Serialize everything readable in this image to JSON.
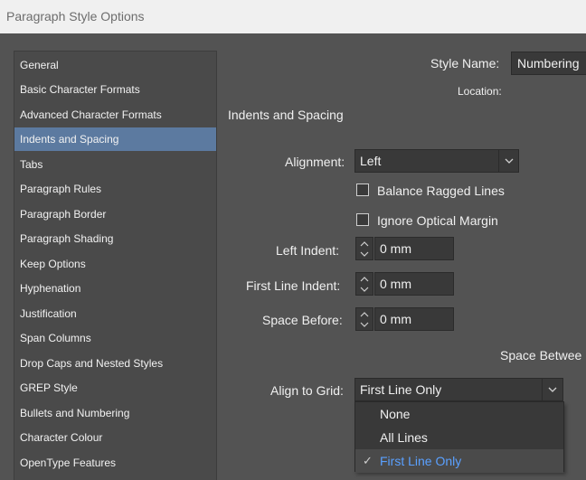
{
  "window": {
    "title": "Paragraph Style Options"
  },
  "sidebar": {
    "items": [
      {
        "label": "General"
      },
      {
        "label": "Basic Character Formats"
      },
      {
        "label": "Advanced Character Formats"
      },
      {
        "label": "Indents and Spacing",
        "selected": true
      },
      {
        "label": "Tabs"
      },
      {
        "label": "Paragraph Rules"
      },
      {
        "label": "Paragraph Border"
      },
      {
        "label": "Paragraph Shading"
      },
      {
        "label": "Keep Options"
      },
      {
        "label": "Hyphenation"
      },
      {
        "label": "Justification"
      },
      {
        "label": "Span Columns"
      },
      {
        "label": "Drop Caps and Nested Styles"
      },
      {
        "label": "GREP Style"
      },
      {
        "label": "Bullets and Numbering"
      },
      {
        "label": "Character Colour"
      },
      {
        "label": "OpenType Features"
      }
    ]
  },
  "header": {
    "style_name_label": "Style Name:",
    "style_name_value": "Numbering",
    "location_label": "Location:"
  },
  "section": {
    "title": "Indents and Spacing"
  },
  "form": {
    "alignment_label": "Alignment:",
    "alignment_value": "Left",
    "balance_ragged_lines_label": "Balance Ragged Lines",
    "balance_ragged_lines_checked": false,
    "ignore_optical_margin_label": "Ignore Optical Margin",
    "ignore_optical_margin_checked": false,
    "left_indent_label": "Left Indent:",
    "left_indent_value": "0 mm",
    "first_line_indent_label": "First Line Indent:",
    "first_line_indent_value": "0 mm",
    "space_before_label": "Space Before:",
    "space_before_value": "0 mm",
    "space_between_label": "Space Betwee",
    "align_to_grid_label": "Align to Grid:",
    "align_to_grid_value": "First Line Only"
  },
  "align_to_grid_menu": {
    "options": [
      {
        "label": "None"
      },
      {
        "label": "All Lines"
      },
      {
        "label": "First Line Only",
        "selected": true
      }
    ],
    "check_glyph": "✓"
  },
  "colors": {
    "background": "#535353",
    "sidebar_selected": "#5c7aa0",
    "menu_selected_text": "#5aa0ff"
  }
}
